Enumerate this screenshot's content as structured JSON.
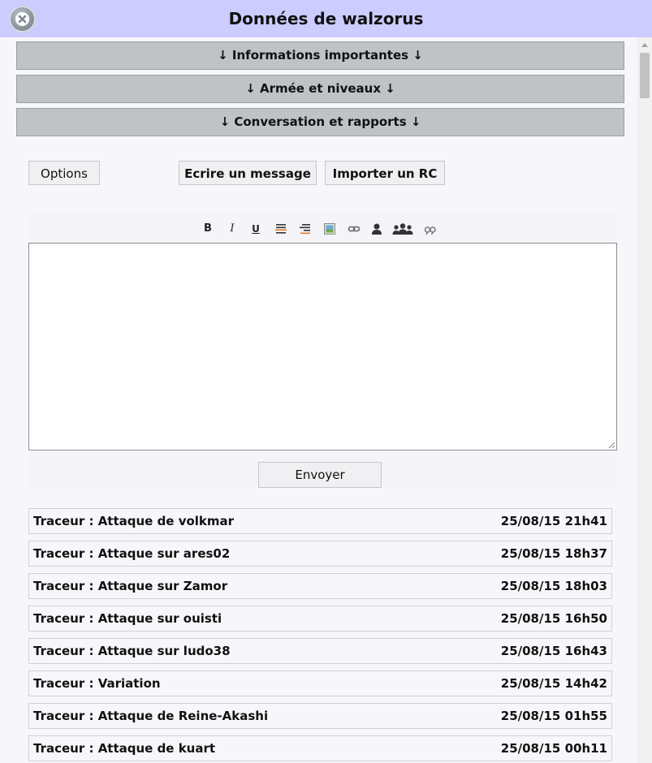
{
  "dialog": {
    "title": "Données de walzorus",
    "close_icon": "close-circle-icon",
    "accent": "#ccccff"
  },
  "sections": [
    {
      "label": "↓ Informations importantes ↓"
    },
    {
      "label": "↓ Armée et niveaux ↓"
    },
    {
      "label": "↓ Conversation et rapports ↓"
    }
  ],
  "actions": {
    "options_label": "Options",
    "write_label": "Ecrire un message",
    "import_label": "Importer un RC"
  },
  "editor": {
    "tools": [
      {
        "name": "bold-icon",
        "glyph": "B"
      },
      {
        "name": "italic-icon",
        "glyph": "I"
      },
      {
        "name": "underline-icon",
        "glyph": "U"
      },
      {
        "name": "strikethrough-icon",
        "glyph": ""
      },
      {
        "name": "align-right-icon",
        "glyph": ""
      },
      {
        "name": "image-icon",
        "glyph": ""
      },
      {
        "name": "link-icon",
        "glyph": ""
      },
      {
        "name": "user-icon",
        "glyph": ""
      },
      {
        "name": "group-icon",
        "glyph": ""
      },
      {
        "name": "quote-icon",
        "glyph": ""
      }
    ],
    "text": "",
    "send_label": "Envoyer"
  },
  "reports": [
    {
      "title": "Traceur : Attaque de volkmar",
      "date": "25/08/15 21h41"
    },
    {
      "title": "Traceur : Attaque sur ares02",
      "date": "25/08/15 18h37"
    },
    {
      "title": "Traceur : Attaque sur Zamor",
      "date": "25/08/15 18h03"
    },
    {
      "title": "Traceur : Attaque sur ouisti",
      "date": "25/08/15 16h50"
    },
    {
      "title": "Traceur : Attaque sur ludo38",
      "date": "25/08/15 16h43"
    },
    {
      "title": "Traceur : Variation",
      "date": "25/08/15 14h42"
    },
    {
      "title": "Traceur : Attaque de Reine-Akashi",
      "date": "25/08/15 01h55"
    },
    {
      "title": "Traceur : Attaque de kuart",
      "date": "25/08/15 00h11"
    }
  ]
}
